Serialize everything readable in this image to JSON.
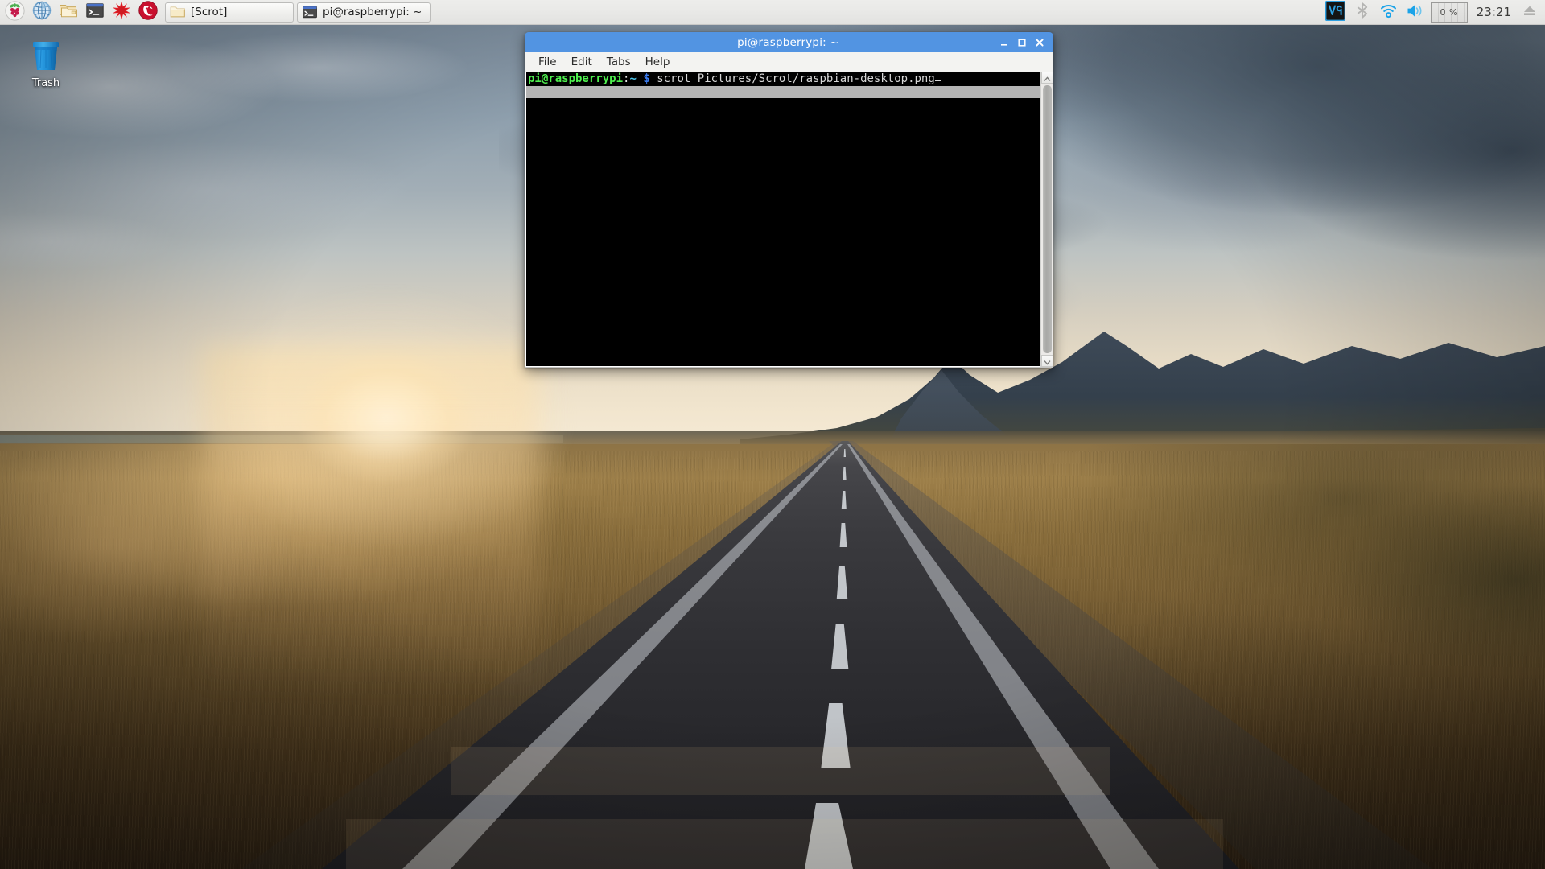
{
  "desktop": {
    "icons": [
      {
        "name": "trash",
        "label": "Trash",
        "icon": "trash-icon"
      }
    ]
  },
  "taskbar": {
    "launchers": [
      {
        "id": "menu",
        "label": "Raspberry Pi Menu",
        "icon": "raspberry-icon"
      },
      {
        "id": "chromium",
        "label": "Chromium Web Browser",
        "icon": "globe-icon"
      },
      {
        "id": "filemanager",
        "label": "File Manager",
        "icon": "folder-icon"
      },
      {
        "id": "terminal",
        "label": "Terminal",
        "icon": "terminal-icon"
      },
      {
        "id": "mathematica",
        "label": "Mathematica",
        "icon": "mathematica-star-icon"
      },
      {
        "id": "wolfram",
        "label": "Wolfram",
        "icon": "wolfram-icon"
      }
    ],
    "window_buttons": [
      {
        "id": "scrot",
        "label": "[Scrot]",
        "icon": "folder-icon",
        "active": false
      },
      {
        "id": "terminal",
        "label": "pi@raspberrypi: ~",
        "icon": "terminal-icon",
        "active": true
      }
    ],
    "tray": {
      "vnc_label": "VNC",
      "bluetooth_label": "Bluetooth",
      "wifi_label": "Wireless Network",
      "volume_label": "Volume",
      "cpu_label": "0 %",
      "clock": "23:21",
      "eject_label": "Eject Removable Media"
    },
    "colors": {
      "background": "#e8e8e6",
      "accent": "#5294e2",
      "vnc_blue": "#2d9fe0",
      "wifi_blue": "#1ba3e8"
    }
  },
  "terminal_window": {
    "title": "pi@raspberrypi: ~",
    "menu": [
      "File",
      "Edit",
      "Tabs",
      "Help"
    ],
    "title_buttons": [
      {
        "id": "minimize",
        "icon": "minimize-icon"
      },
      {
        "id": "maximize",
        "icon": "maximize-icon"
      },
      {
        "id": "close",
        "icon": "close-icon"
      }
    ],
    "prompt": {
      "user_host": "pi@raspberrypi",
      "colon": ":",
      "path": "~",
      "dollar": "$"
    },
    "command": "scrot Pictures/Scrot/raspbian-desktop.png",
    "colors": {
      "titlebar": "#5294e2",
      "screen_bg": "#000000",
      "prompt_green": "#4ef04e",
      "path_cyan": "#4ec9f0",
      "dollar_blue": "#3a7bf0",
      "text_grey": "#d8d8d8",
      "selection_grey": "#b4b4b4"
    }
  }
}
